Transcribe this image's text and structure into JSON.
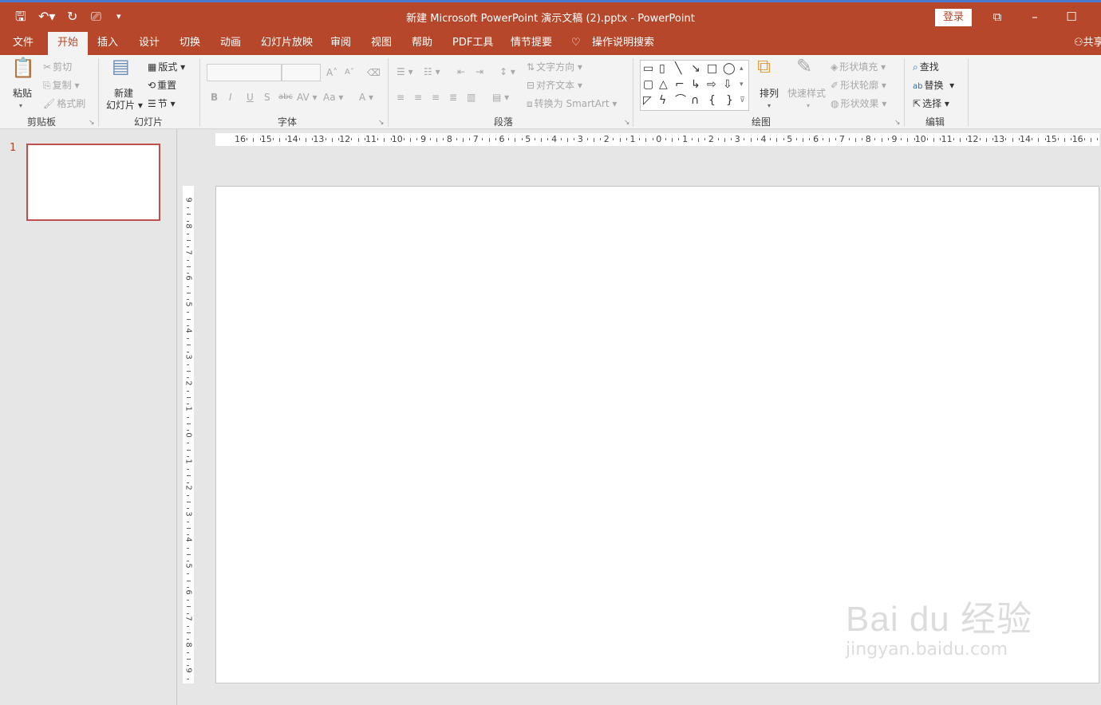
{
  "window": {
    "title": "新建 Microsoft PowerPoint 演示文稿 (2).pptx  -  PowerPoint",
    "login": "登录",
    "share": "共享"
  },
  "quick_access": {
    "save": "save-icon",
    "undo": "undo-icon",
    "redo": "redo-icon",
    "present": "present-icon",
    "customize": "▾"
  },
  "tabs": {
    "file": "文件",
    "home": "开始",
    "insert": "插入",
    "design": "设计",
    "transitions": "切换",
    "animations": "动画",
    "slideshow": "幻灯片放映",
    "review": "审阅",
    "view": "视图",
    "help": "帮助",
    "pdf": "PDF工具",
    "storyboard": "情节提要",
    "tellme": "操作说明搜索"
  },
  "ribbon": {
    "clipboard": {
      "label": "剪贴板",
      "paste": "粘贴",
      "cut": "剪切",
      "copy": "复制",
      "format_painter": "格式刷"
    },
    "slides": {
      "label": "幻灯片",
      "new_slide_1": "新建",
      "new_slide_2": "幻灯片",
      "layout": "版式",
      "reset": "重置",
      "section": "节"
    },
    "font": {
      "label": "字体",
      "bold": "B",
      "italic": "I",
      "underline": "U",
      "shadow": "S",
      "strike": "abc",
      "spacing": "AV",
      "case": "Aa",
      "color": "A",
      "grow": "A",
      "shrink": "A"
    },
    "paragraph": {
      "label": "段落",
      "text_direction": "文字方向",
      "align_text": "对齐文本",
      "smartart": "转换为 SmartArt"
    },
    "drawing": {
      "label": "绘图",
      "arrange": "排列",
      "quick_styles": "快速样式",
      "fill": "形状填充",
      "outline": "形状轮廓",
      "effects": "形状效果"
    },
    "editing": {
      "label": "编辑",
      "find": "查找",
      "replace": "替换",
      "select": "选择"
    }
  },
  "slides_panel": {
    "slide_number": "1"
  },
  "ruler": {
    "h_labels": [
      "16",
      "15",
      "14",
      "13",
      "12",
      "11",
      "10",
      "9",
      "8",
      "7",
      "6",
      "5",
      "4",
      "3",
      "2",
      "1",
      "0",
      "1",
      "2",
      "3",
      "4",
      "5",
      "6",
      "7",
      "8",
      "9",
      "10",
      "11",
      "12",
      "13",
      "14",
      "15",
      "16"
    ],
    "v_labels": [
      "9",
      "8",
      "7",
      "6",
      "5",
      "4",
      "3",
      "2",
      "1",
      "0",
      "1",
      "2",
      "3",
      "4",
      "5",
      "6",
      "7",
      "8",
      "9"
    ]
  },
  "watermark": {
    "main": "Bai du 经验",
    "sub": "jingyan.baidu.com"
  }
}
